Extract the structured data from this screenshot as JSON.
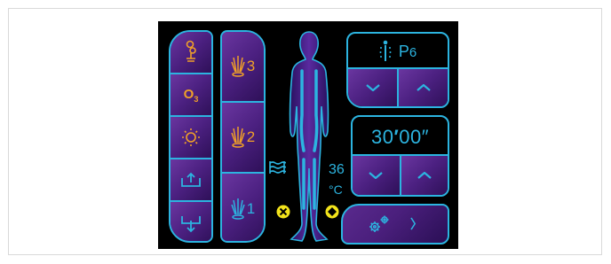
{
  "treatment_panel": {
    "left_column": {
      "ozone_label": "O",
      "ozone_sub": "3"
    },
    "jet_column": {
      "level_3": "3",
      "level_2": "2",
      "level_1": "1"
    },
    "body": {
      "temperature_value": "36",
      "temperature_unit": "°C"
    },
    "program": {
      "label": "P",
      "number": "6"
    },
    "timer": {
      "minutes": "30",
      "minutes_mark": "′",
      "seconds": "00",
      "seconds_mark": "″"
    },
    "settings": {
      "next_label": "〉"
    }
  },
  "colors": {
    "accent_blue": "#2cb4e0",
    "accent_orange": "#f0a028",
    "accent_yellow": "#f2e31b",
    "button_purple": "#4b2080",
    "panel_bg": "#000000"
  }
}
